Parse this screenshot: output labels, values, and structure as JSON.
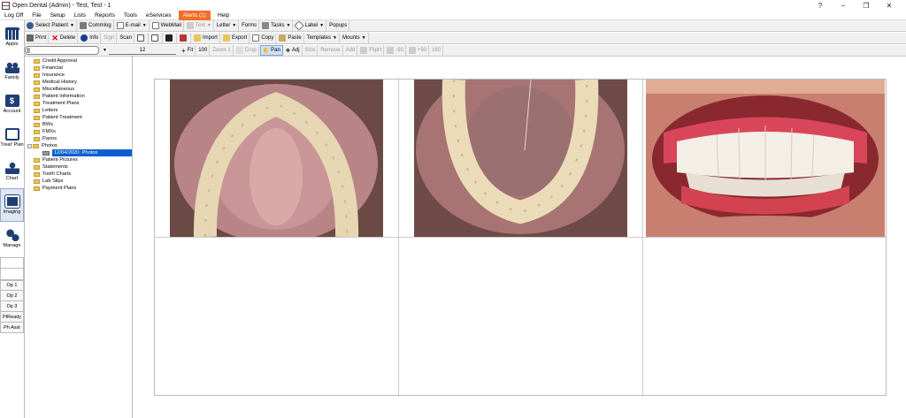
{
  "window": {
    "title": "Open Dental (Admin) - Test, Test - 1",
    "controls": [
      "?",
      "–",
      "❐",
      "✕"
    ]
  },
  "menu": [
    "Log Off",
    "File",
    "Setup",
    "Lists",
    "Reports",
    "Tools",
    "eServices",
    "Alerts (1)",
    "Help"
  ],
  "toolbar1": {
    "select_patient": "Select Patient",
    "commlog": "Commlog",
    "email": "E-mail",
    "webmail": "WebMail",
    "text": "Text",
    "letter": "Letter",
    "forms": "Forms",
    "tasks": "Tasks",
    "label": "Label",
    "popups": "Popups"
  },
  "toolbar2": {
    "print": "Print",
    "delete": "Delete",
    "info": "Info",
    "sign": "Sign",
    "scan": "Scan",
    "import": "Import",
    "export": "Export",
    "copy": "Copy",
    "paste": "Paste",
    "templates": "Templates",
    "mounts": "Mounts"
  },
  "toolbar3": {
    "zoom_value": "12",
    "fit": "Fit",
    "zoom100": "100",
    "zoom1": "Zoom 1",
    "crop": "Crop",
    "pan": "Pan",
    "adj": "Adj",
    "size": "Size",
    "remove": "Remove",
    "add": "Add",
    "flip_h": "FlipH",
    "rot_minus90": "-90",
    "rot_plus90": "+90",
    "rot180": "180"
  },
  "modules": [
    {
      "label": "Appts",
      "icon": "calendar-icon"
    },
    {
      "label": "Family",
      "icon": "family-icon"
    },
    {
      "label": "Account",
      "icon": "account-icon"
    },
    {
      "label": "Treat' Plan",
      "icon": "treatplan-icon"
    },
    {
      "label": "Chart",
      "icon": "chart-icon"
    },
    {
      "label": "Imaging",
      "icon": "imaging-icon"
    },
    {
      "label": "Manage",
      "icon": "gears-icon"
    }
  ],
  "ops": [
    "Op 1",
    "Op 2",
    "Op 3",
    "PtReady",
    "Ph Asst"
  ],
  "tree": [
    "Credit Approval",
    "Financial",
    "Insurance",
    "Medical History",
    "Miscellaneous",
    "Patient Information",
    "Treatment Plans",
    "Letters",
    "Patient Treatment",
    "BWs",
    "FMXs",
    "Panos",
    "Photos",
    "12/04/2020: Photos",
    "Patient Pictures",
    "Statements",
    "Tooth Charts",
    "Lab Slips",
    "Payment Plans"
  ],
  "colors": {
    "alert_bg": "#f26d2a",
    "selection": "#0a5fd0",
    "folder": "#e9c65a"
  }
}
